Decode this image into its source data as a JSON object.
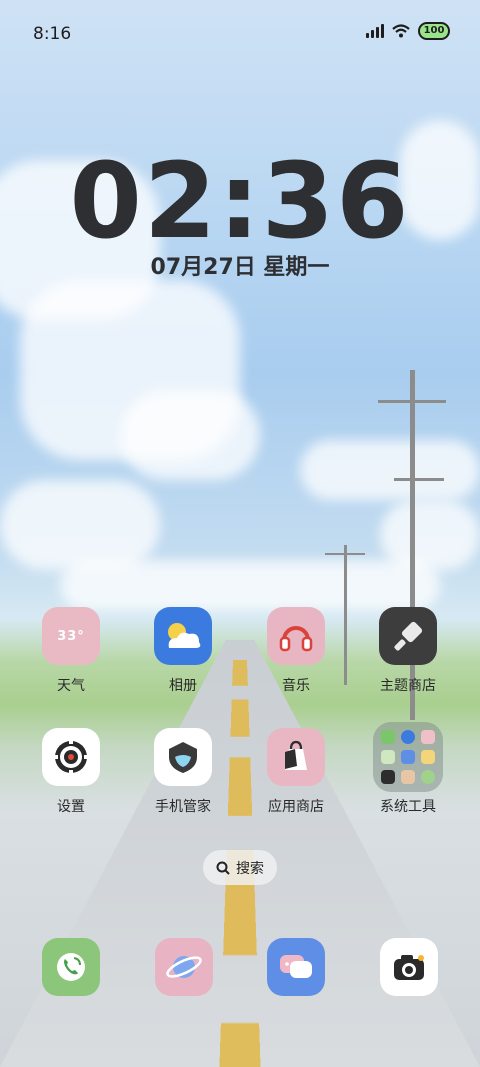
{
  "status_bar": {
    "time": "8:16",
    "battery": "100"
  },
  "lockclock": {
    "time": "02:36",
    "date": "07月27日 星期一"
  },
  "apps": [
    {
      "label": "天气",
      "icon_text": "33°"
    },
    {
      "label": "相册"
    },
    {
      "label": "音乐"
    },
    {
      "label": "主题商店"
    },
    {
      "label": "设置"
    },
    {
      "label": "手机管家"
    },
    {
      "label": "应用商店"
    },
    {
      "label": "系统工具"
    }
  ],
  "search": {
    "label": "搜索"
  },
  "dock": [
    "phone-icon",
    "browser-icon",
    "messages-icon",
    "camera-icon"
  ],
  "colors": {
    "weather": "#e9b9c4",
    "gallery": "#3b7be0",
    "music": "#e7b6c2",
    "theme": "#3d3d3d",
    "phone": "#8cc67a",
    "browser": "#e8b4c4",
    "messages": "#5e8ee6",
    "camera": "#ffffff"
  }
}
